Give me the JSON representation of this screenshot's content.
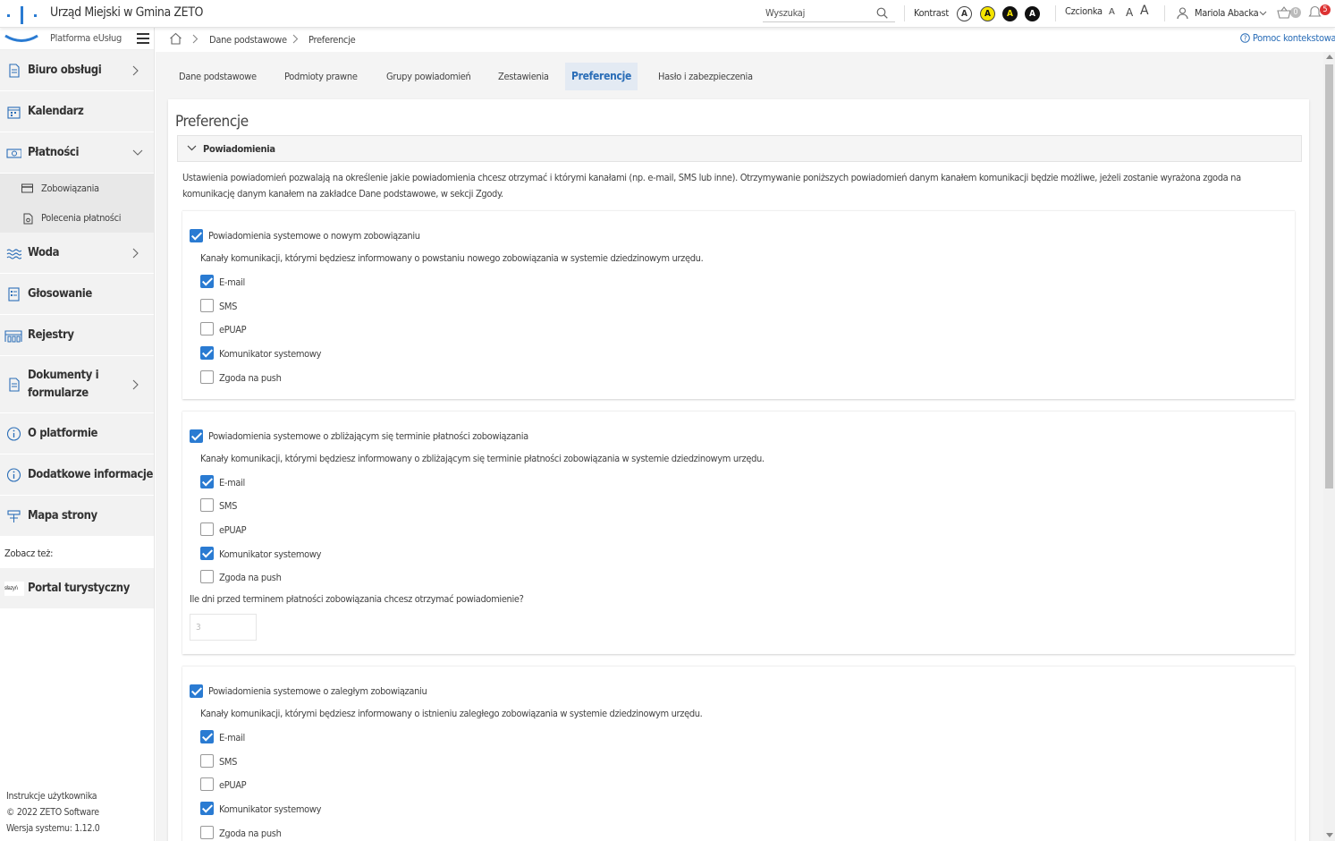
{
  "header": {
    "title": "Urząd Miejski w Gmina ZETO",
    "search_placeholder": "Wyszukaj",
    "contrast_label": "Kontrast",
    "contrast_options": [
      "A",
      "A",
      "A",
      "A"
    ],
    "font_label": "Czcionka",
    "font_options": [
      "A",
      "A",
      "A"
    ],
    "user_name": "Mariola Abacka",
    "basket_count": "0",
    "notifications_count": "5"
  },
  "sidebar": {
    "platform_label": "Platforma eUsług",
    "items": [
      {
        "label": "Biuro obsługi",
        "icon": "document-icon"
      },
      {
        "label": "Kalendarz",
        "icon": "calendar-icon"
      },
      {
        "label": "Płatności",
        "icon": "money-icon"
      },
      {
        "label": "Woda",
        "icon": "water-icon"
      },
      {
        "label": "Głosowanie",
        "icon": "ballot-icon"
      },
      {
        "label": "Rejestry",
        "icon": "register-icon"
      },
      {
        "label": "Dokumenty i formularze",
        "icon": "document-icon"
      },
      {
        "label": "O platformie",
        "icon": "info-icon"
      },
      {
        "label": "Dodatkowe informacje",
        "icon": "info-icon"
      },
      {
        "label": "Mapa strony",
        "icon": "sitemap-icon"
      }
    ],
    "sub_items": [
      "Zobowiązania",
      "Polecenia płatności"
    ],
    "see_also_label": "Zobacz też:",
    "portal_label": "Portal turystyczny",
    "portal_logo_text": "słazyń",
    "footer": [
      "Instrukcje użytkownika",
      "© 2022 ZETO Software",
      "Wersja systemu: 1.12.0"
    ]
  },
  "breadcrumb": [
    "Dane podstawowe",
    "Preferencje"
  ],
  "help_label": "Pomoc kontekstowa",
  "tabs": [
    "Dane podstawowe",
    "Podmioty prawne",
    "Grupy powiadomień",
    "Zestawienia",
    "Preferencje",
    "Hasło i zabezpieczenia"
  ],
  "page_title": "Preferencje",
  "section_title": "Powiadomienia",
  "description": "Ustawienia powiadomień pozwalają na określenie jakie powiadomienia chcesz otrzymać i którymi kanałami (np. e-mail, SMS lub inne). Otrzymywanie poniższych powiadomień danym kanałem komunikacji będzie możliwe, jeżeli zostanie wyrażona zgoda na komunikację danym kanałem na zakładce Dane podstawowe, w sekcji Zgody.",
  "blocks": [
    {
      "title": "Powiadomienia systemowe o nowym zobowiązaniu",
      "checked": true,
      "info": "Kanały komunikacji, którymi będziesz informowany o powstaniu nowego zobowiązania w systemie dziedzinowym urzędu.",
      "channels": [
        {
          "label": "E-mail",
          "checked": true
        },
        {
          "label": "SMS",
          "checked": false
        },
        {
          "label": "ePUAP",
          "checked": false
        },
        {
          "label": "Komunikator systemowy",
          "checked": true
        },
        {
          "label": "Zgoda na push",
          "checked": false
        }
      ]
    },
    {
      "title": "Powiadomienia systemowe o zbliżającym się terminie płatności zobowiązania",
      "checked": true,
      "info": "Kanały komunikacji, którymi będziesz informowany o zbliżającym się terminie płatności zobowiązania w systemie dziedzinowym urzędu.",
      "channels": [
        {
          "label": "E-mail",
          "checked": true
        },
        {
          "label": "SMS",
          "checked": false
        },
        {
          "label": "ePUAP",
          "checked": false
        },
        {
          "label": "Komunikator systemowy",
          "checked": true
        },
        {
          "label": "Zgoda na push",
          "checked": false
        }
      ],
      "days_question": "Ile dni przed terminem płatności zobowiązania chcesz otrzymać powiadomienie?",
      "days_placeholder": "3"
    },
    {
      "title": "Powiadomienia systemowe o zaległym zobowiązaniu",
      "checked": true,
      "info": "Kanały komunikacji, którymi będziesz informowany o istnieniu zaległego zobowiązania w systemie dziedzinowym urzędu.",
      "channels": [
        {
          "label": "E-mail",
          "checked": true
        },
        {
          "label": "SMS",
          "checked": false
        },
        {
          "label": "ePUAP",
          "checked": false
        },
        {
          "label": "Komunikator systemowy",
          "checked": true
        },
        {
          "label": "Zgoda na push",
          "checked": false
        }
      ]
    }
  ],
  "colors": {
    "accent": "#2a7bd2",
    "link": "#2a6db7",
    "contrast_yellow": "#f5e400",
    "contrast_black": "#111111",
    "badge_red": "#dd3333"
  }
}
